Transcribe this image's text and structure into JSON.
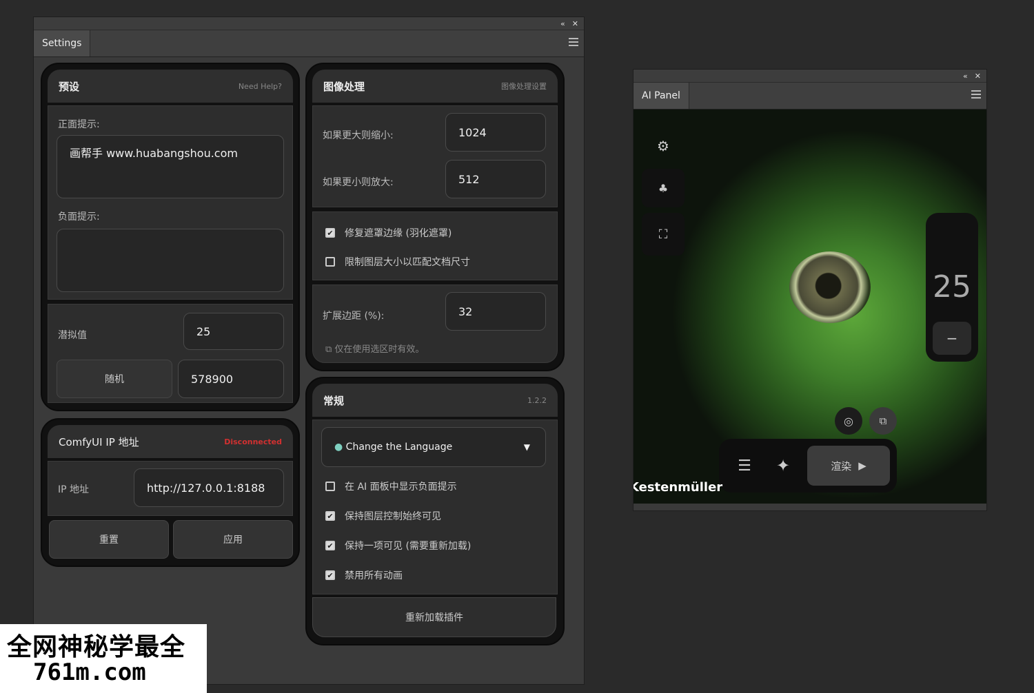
{
  "settings_window": {
    "title_controls": {
      "collapse": "«",
      "close": "✕"
    },
    "tab": "Settings",
    "presets": {
      "title": "预设",
      "help": "Need Help?",
      "positive_label": "正面提示:",
      "positive_value": "画帮手 www.huabangshou.com",
      "negative_label": "负面提示:",
      "negative_value": "",
      "denoise_label": "潜拟值",
      "denoise_value": "25",
      "random_button": "随机",
      "seed_value": "578900"
    },
    "comfy": {
      "title": "ComfyUI IP 地址",
      "status": "Disconnected",
      "ip_label": "IP 地址",
      "ip_value": "http://127.0.0.1:8188",
      "reset_button": "重置",
      "apply_button": "应用"
    },
    "image_processing": {
      "title": "图像处理",
      "subtitle": "图像处理设置",
      "shrink_label": "如果更大则缩小:",
      "shrink_value": "1024",
      "enlarge_label": "如果更小则放大:",
      "enlarge_value": "512",
      "check_mask": "修复遮罩边缘 (羽化遮罩)",
      "check_mask_on": true,
      "check_limit": "限制图层大小以匹配文档尺寸",
      "check_limit_on": false,
      "expand_label": "扩展边距 (%):",
      "expand_value": "32",
      "note": "仅在使用选区时有效。"
    },
    "general": {
      "title": "常规",
      "version": "1.2.2",
      "language_select": "Change the Language",
      "options": [
        {
          "label": "在 AI 面板中显示负面提示",
          "checked": false
        },
        {
          "label": "保持图层控制始终可见",
          "checked": true
        },
        {
          "label": "保持一项可见 (需要重新加载)",
          "checked": true
        },
        {
          "label": "禁用所有动画",
          "checked": true
        }
      ],
      "reload_button": "重新加载插件"
    }
  },
  "ai_panel": {
    "title_controls": {
      "collapse": "«",
      "close": "✕"
    },
    "tab": "AI Panel",
    "slider_value": "25",
    "slider_minus": "−",
    "render_button": "渲染",
    "caption": "Kestenmüller",
    "icons": [
      "gear-icon",
      "layers-icon",
      "fullscreen-icon",
      "refresh-icon",
      "crop-icon",
      "list-icon",
      "sparkle-icon",
      "play-icon"
    ]
  },
  "watermark": {
    "line1": "全网神秘学最全",
    "line2": "761m.com"
  }
}
